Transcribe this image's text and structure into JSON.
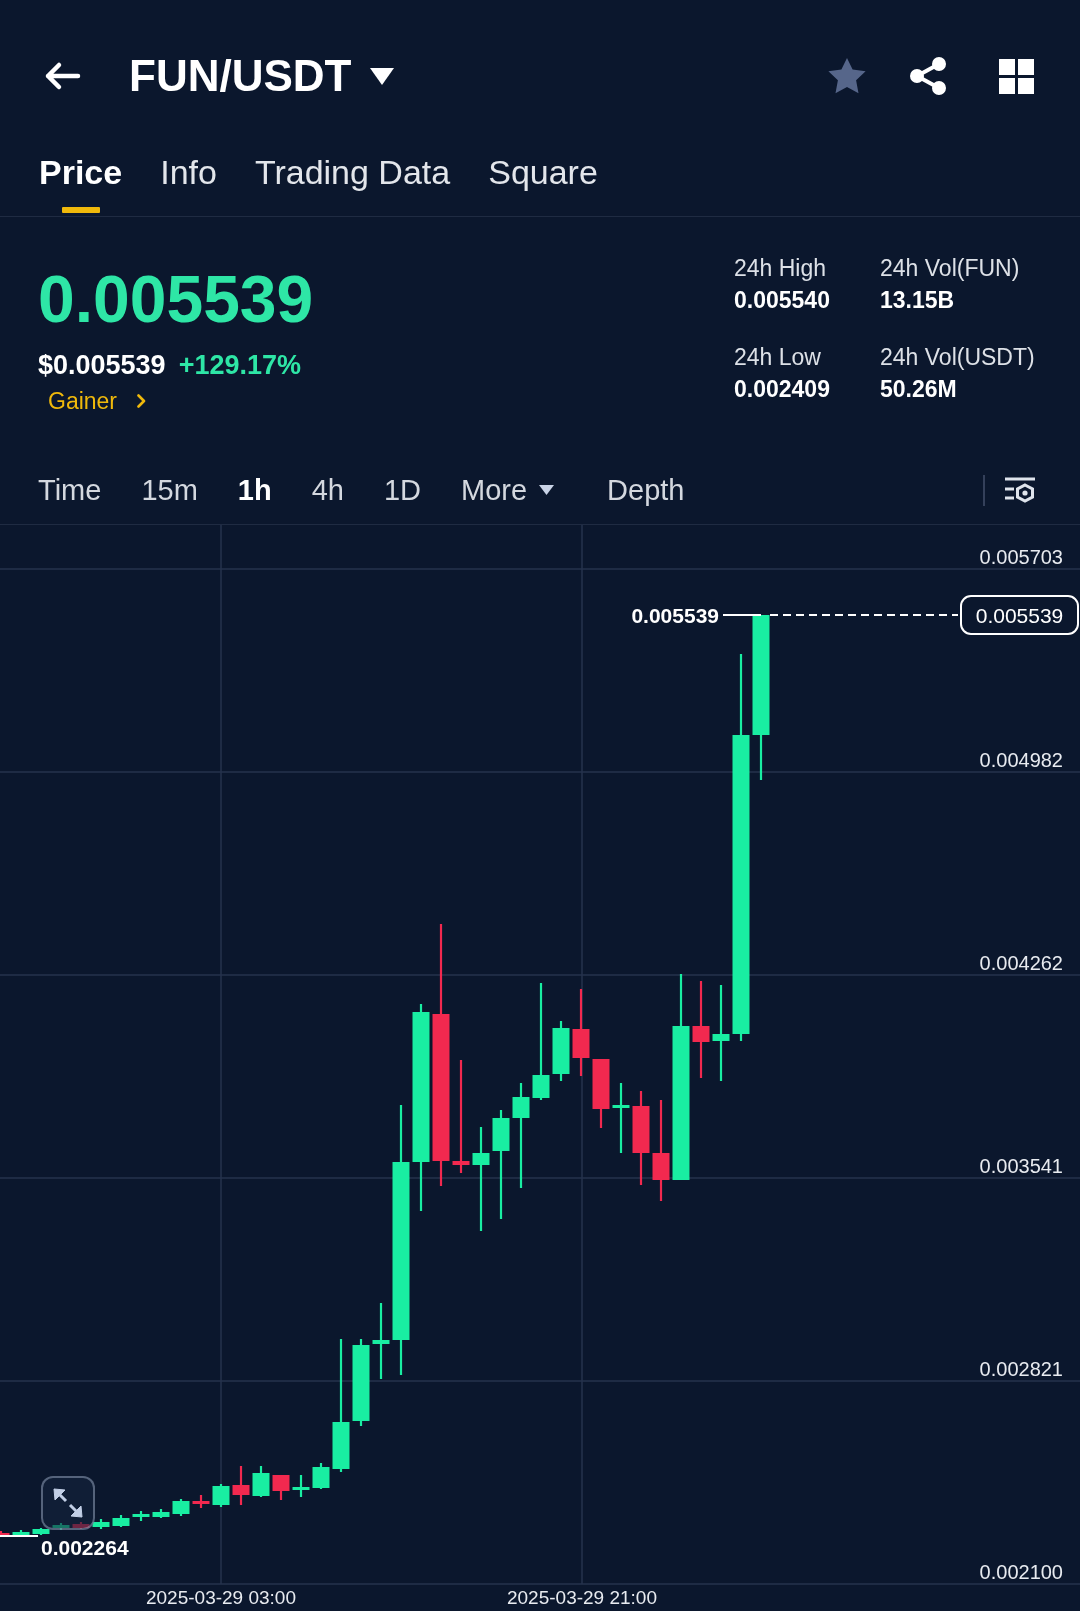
{
  "header": {
    "pair": "FUN/USDT",
    "favorited": false
  },
  "tabs": [
    {
      "label": "Price",
      "selected": true
    },
    {
      "label": "Info",
      "selected": false
    },
    {
      "label": "Trading Data",
      "selected": false
    },
    {
      "label": "Square",
      "selected": false
    }
  ],
  "ticker": {
    "last_price": "0.005539",
    "rising": true,
    "usd_price": "$0.005539",
    "change": "+129.17%",
    "tag": "Gainer"
  },
  "stats": [
    {
      "label": "24h High",
      "value": "0.005540"
    },
    {
      "label": "24h Vol(FUN)",
      "value": "13.15B"
    },
    {
      "label": "24h Low",
      "value": "0.002409"
    },
    {
      "label": "24h Vol(USDT)",
      "value": "50.26M"
    }
  ],
  "intervals": [
    {
      "label": "Time",
      "kind": "interval",
      "selected": false
    },
    {
      "label": "15m",
      "kind": "interval",
      "selected": false
    },
    {
      "label": "1h",
      "kind": "interval",
      "selected": true
    },
    {
      "label": "4h",
      "kind": "interval",
      "selected": false
    },
    {
      "label": "1D",
      "kind": "interval",
      "selected": false
    },
    {
      "label": "More",
      "kind": "dropdown",
      "selected": false
    },
    {
      "label": "Depth",
      "kind": "view",
      "selected": false
    }
  ],
  "chart": {
    "price_axis": [
      "0.005703",
      "0.004982",
      "0.004262",
      "0.003541",
      "0.002821",
      "0.002100"
    ],
    "time_axis": [
      "2025-03-29 03:00",
      "2025-03-29 21:00"
    ],
    "high_label": "0.005539",
    "last_price_tag": "0.005539",
    "low_label": "0.002264"
  }
}
